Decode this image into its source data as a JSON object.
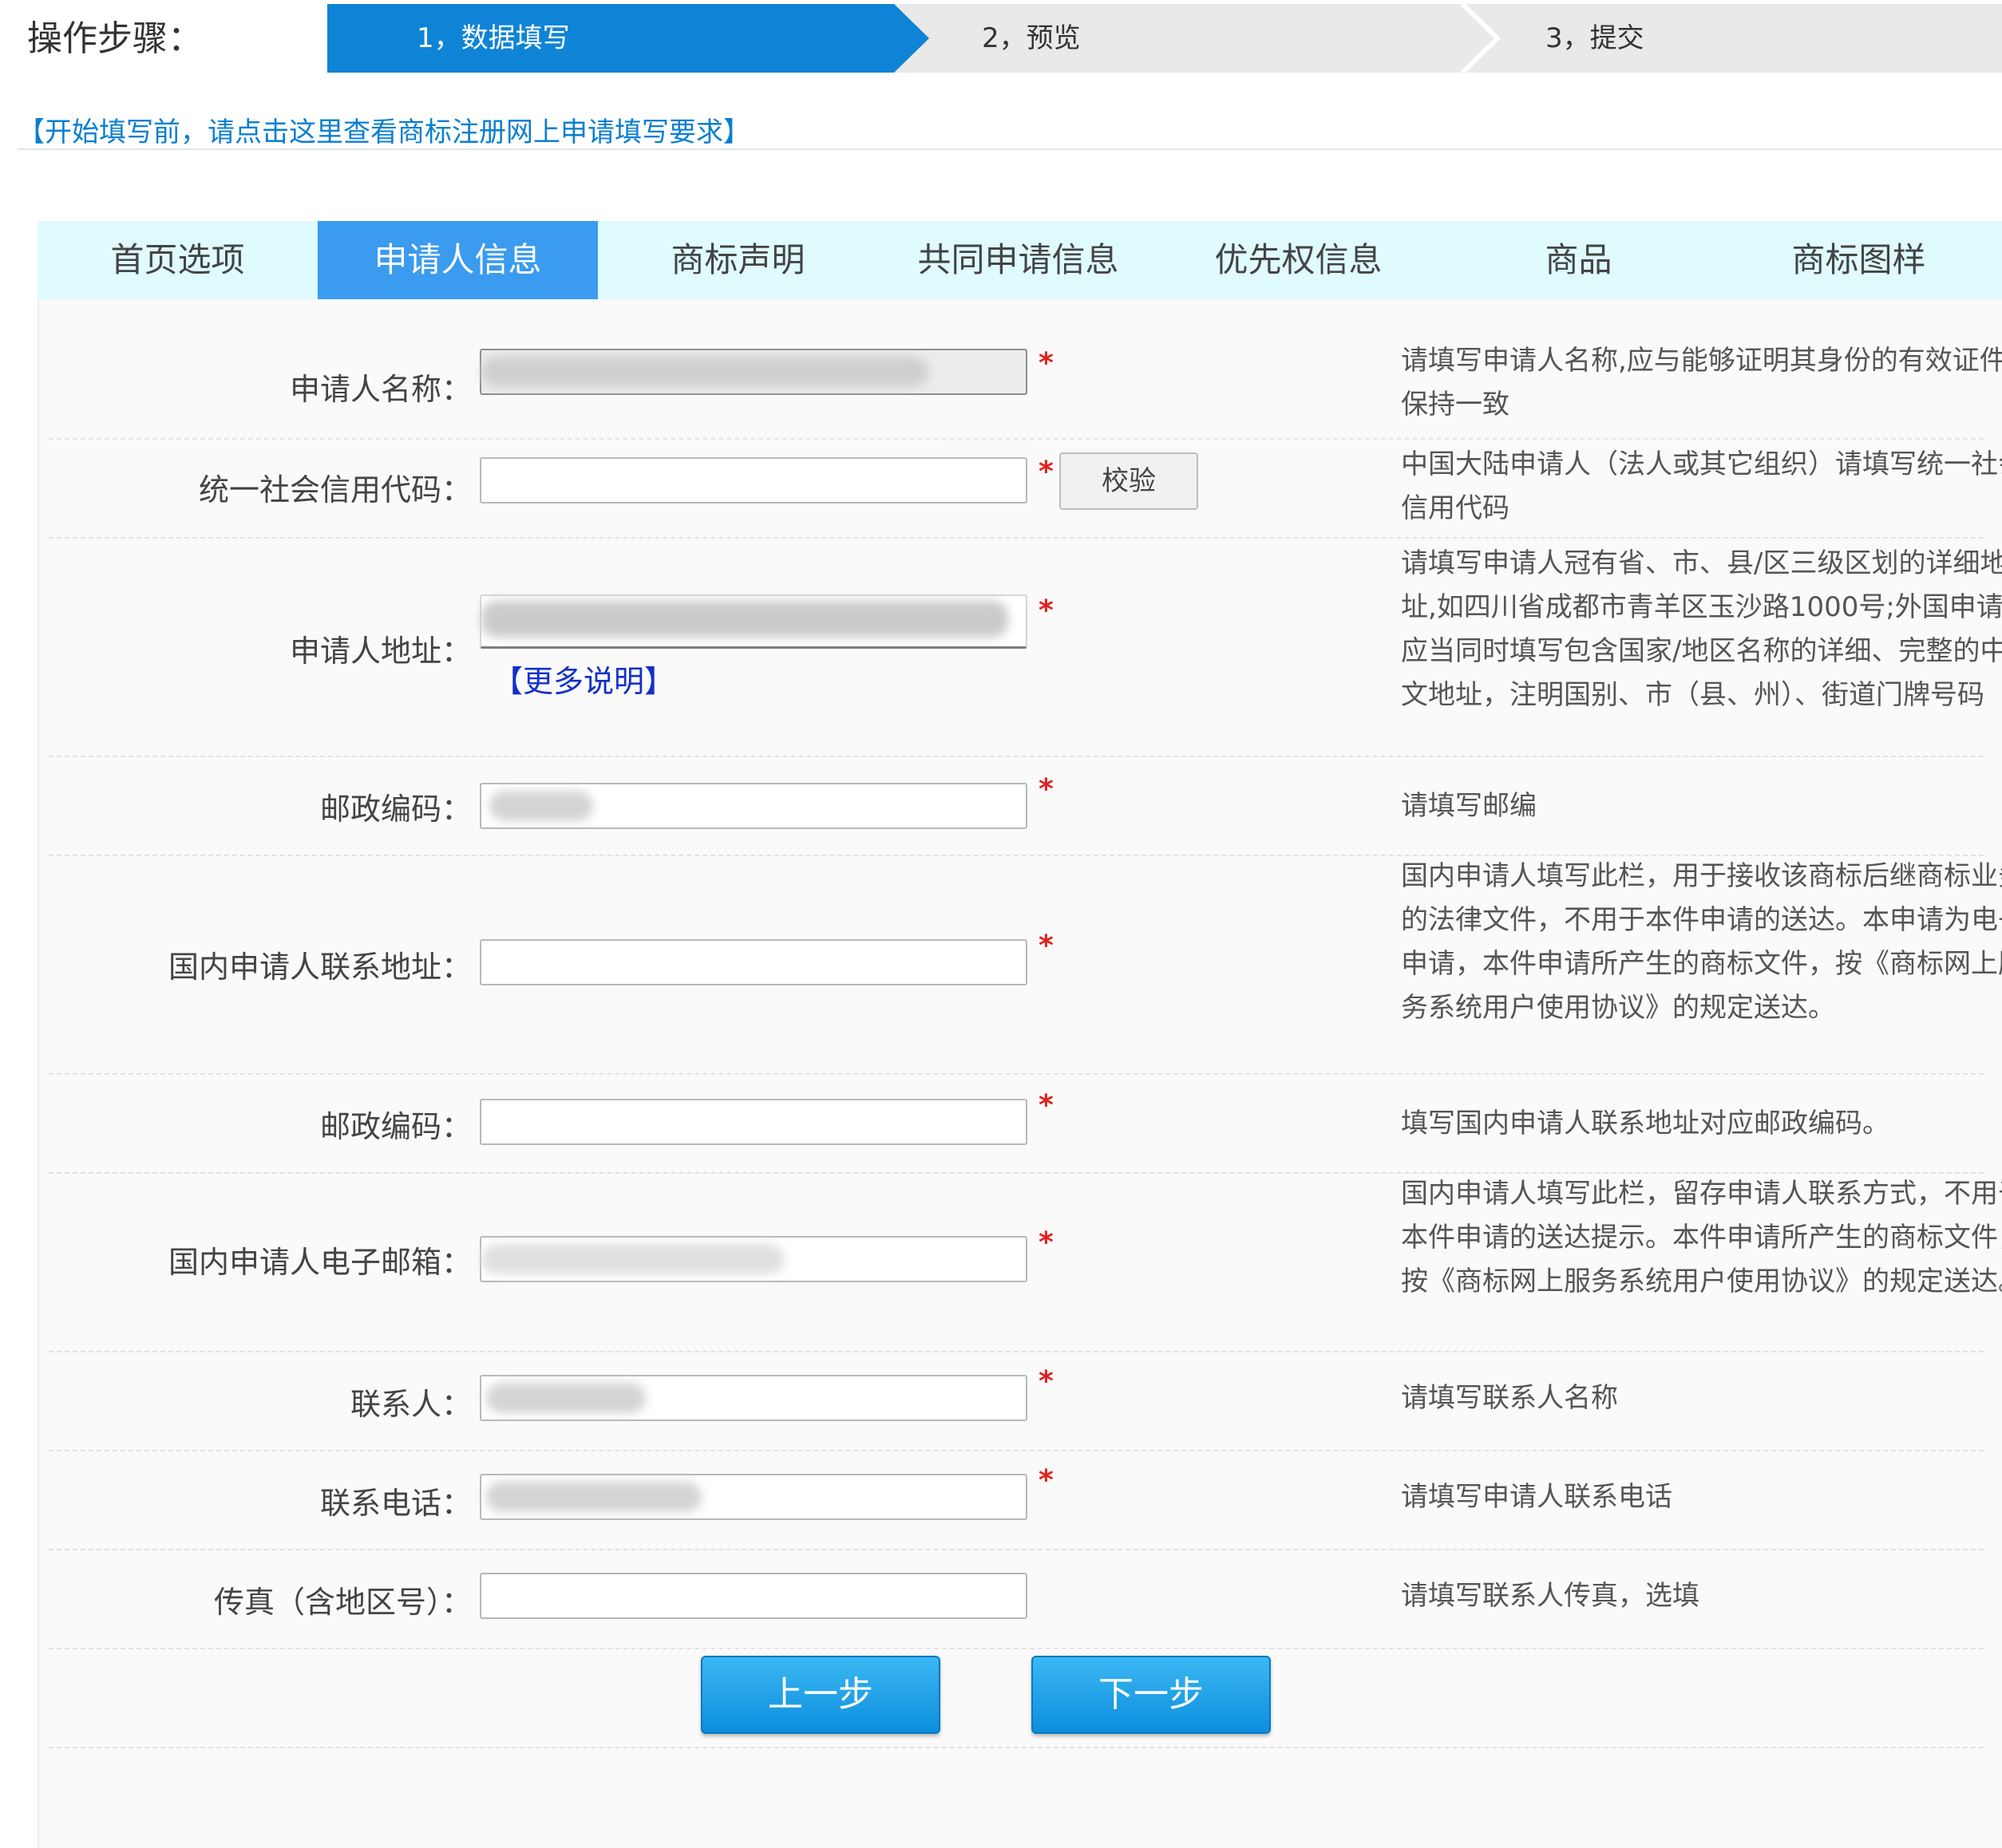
{
  "steps": {
    "label": "操作步骤：",
    "items": [
      {
        "label": "1，数据填写",
        "active": true
      },
      {
        "label": "2，预览",
        "active": false
      },
      {
        "label": "3，提交",
        "active": false
      }
    ]
  },
  "notice_link": "【开始填写前，请点击这里查看商标注册网上申请填写要求】",
  "tabs": [
    {
      "label": "首页选项",
      "active": false
    },
    {
      "label": "申请人信息",
      "active": true
    },
    {
      "label": "商标声明",
      "active": false
    },
    {
      "label": "共同申请信息",
      "active": false
    },
    {
      "label": "优先权信息",
      "active": false
    },
    {
      "label": "商品",
      "active": false
    },
    {
      "label": "商标图样",
      "active": false
    }
  ],
  "required_mark": "*",
  "fields": {
    "applicant_name": {
      "label": "申请人名称：",
      "help": "请填写申请人名称,应与能够证明其身份的有效证件保持一致"
    },
    "credit_code": {
      "label": "统一社会信用代码：",
      "verify_button": "校验",
      "help": "中国大陆申请人（法人或其它组织）请填写统一社会信用代码"
    },
    "applicant_address": {
      "label": "申请人地址：",
      "more_link": "【更多说明】",
      "help": "请填写申请人冠有省、市、县/区三级区划的详细地址,如四川省成都市青羊区玉沙路1000号;外国申请人应当同时填写包含国家/地区名称的详细、完整的中文地址，注明国别、市（县、州）、街道门牌号码"
    },
    "postal_code": {
      "label": "邮政编码：",
      "help": "请填写邮编"
    },
    "domestic_address": {
      "label": "国内申请人联系地址：",
      "help": "国内申请人填写此栏，用于接收该商标后继商标业务的法律文件，不用于本件申请的送达。本申请为电子申请，本件申请所产生的商标文件，按《商标网上服务系统用户使用协议》的规定送达。"
    },
    "domestic_postal_code": {
      "label": "邮政编码：",
      "help": "填写国内申请人联系地址对应邮政编码。"
    },
    "email": {
      "label": "国内申请人电子邮箱：",
      "help": "国内申请人填写此栏，留存申请人联系方式，不用于本件申请的送达提示。本件申请所产生的商标文件，按《商标网上服务系统用户使用协议》的规定送达。"
    },
    "contact_person": {
      "label": "联系人：",
      "help": "请填写联系人名称"
    },
    "contact_phone": {
      "label": "联系电话：",
      "help": "请填写申请人联系电话"
    },
    "fax": {
      "label": "传真（含地区号）：",
      "help": "请填写联系人传真，选填"
    }
  },
  "buttons": {
    "prev": "上一步",
    "next": "下一步"
  },
  "colors": {
    "step_active": "#0f84d6",
    "tab_active": "#3a9bef",
    "tab_bar": "#dffbfe",
    "required": "#e0221e",
    "notice_link": "#0a7fd0",
    "more_link": "#1530c8"
  }
}
